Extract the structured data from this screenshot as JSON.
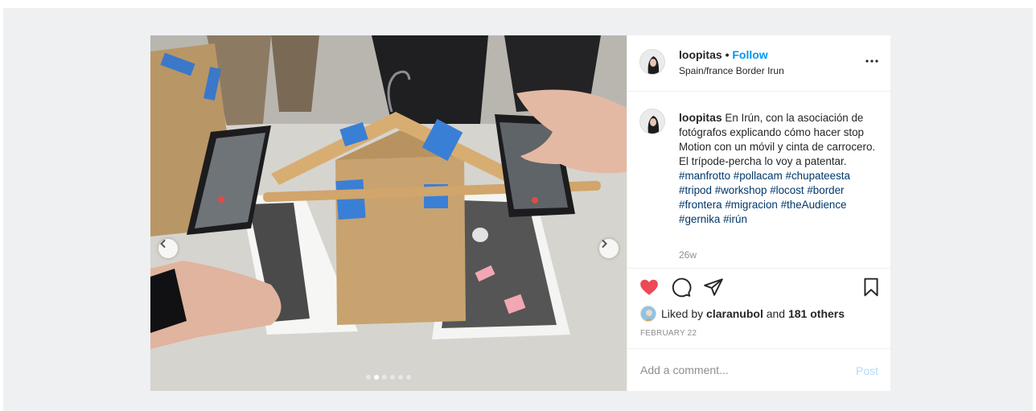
{
  "post": {
    "username": "loopitas",
    "separator": "•",
    "follow_label": "Follow",
    "location": "Spain/france Border Irun",
    "more_icon": "more-dots-icon",
    "caption_user": "loopitas",
    "caption_text": "En Irún, con la asociación de fotógrafos explicando cómo hacer stop Motion con un móvil y cinta de carrocero. El trípode-percha lo voy a patentar.",
    "hashtags": [
      "#manfrotto",
      "#pollacam",
      "#chupateesta",
      "#tripod",
      "#workshop",
      "#locost",
      "#border",
      "#frontera",
      "#migracion",
      "#theAudience",
      "#gernika",
      "#irún"
    ],
    "age": "26w",
    "likes_prefix": "Liked by",
    "liked_by_user": "claranubol",
    "likes_and": "and",
    "likes_others": "181 others",
    "date": "FEBRUARY 22",
    "comment_placeholder": "Add a comment...",
    "post_label": "Post"
  },
  "carousel": {
    "slide_count": 6,
    "active_index": 1
  },
  "colors": {
    "accent": "#0095f6",
    "like_red": "#ed4956",
    "hashtag": "#00376b",
    "muted": "#8e8e8e",
    "post_disabled": "#b3dbff"
  }
}
